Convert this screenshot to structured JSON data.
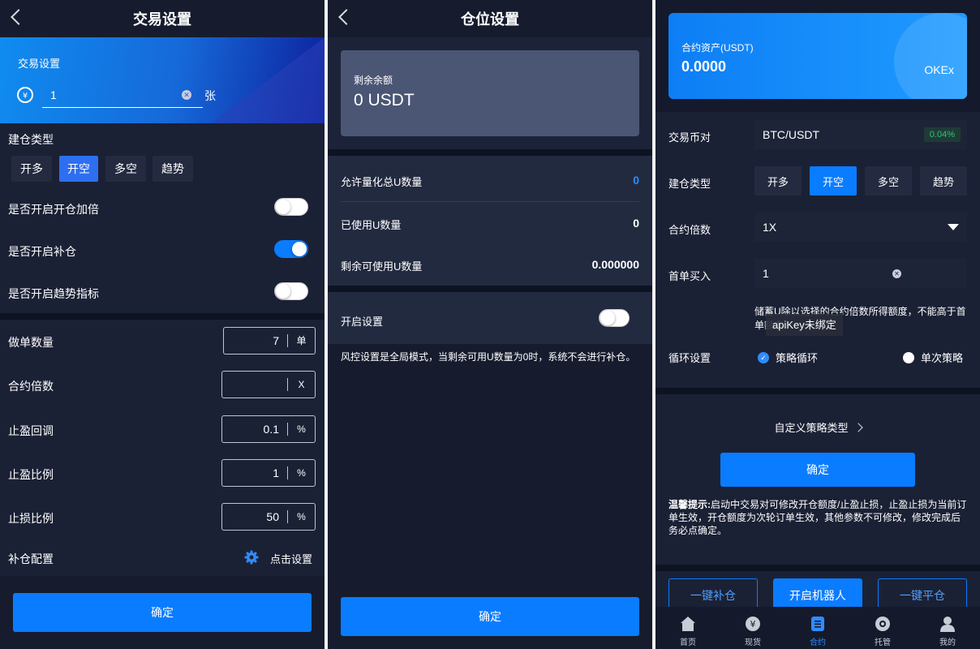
{
  "p1": {
    "title": "交易设置",
    "banner_label": "交易设置",
    "qty_value": "1",
    "qty_unit": "张",
    "build_type_label": "建仓类型",
    "build_types": [
      "开多",
      "开空",
      "多空",
      "趋势"
    ],
    "toggles": [
      {
        "label": "是否开启开仓加倍",
        "on": false
      },
      {
        "label": "是否开启补仓",
        "on": true
      },
      {
        "label": "是否开启趋势指标",
        "on": false
      }
    ],
    "fields": [
      {
        "label": "做单数量",
        "value": "7",
        "unit": "单"
      },
      {
        "label": "合约倍数",
        "value": "",
        "unit": "X"
      },
      {
        "label": "止盈回调",
        "value": "0.1",
        "unit": "%"
      },
      {
        "label": "止盈比例",
        "value": "1",
        "unit": "%"
      },
      {
        "label": "止损比例",
        "value": "50",
        "unit": "%"
      }
    ],
    "bucang_label": "补仓配置",
    "bucang_action": "点击设置",
    "confirm": "确定"
  },
  "p2": {
    "title": "仓位设置",
    "balance_label": "剩余余额",
    "balance_value": "0 USDT",
    "rows": [
      {
        "label": "允许量化总U数量",
        "value": "0"
      },
      {
        "label": "已使用U数量",
        "value": "0"
      },
      {
        "label": "剩余可使用U数量",
        "value": "0.000000"
      }
    ],
    "open_label": "开启设置",
    "note": "风控设置是全局模式，当剩余可用U数量为0时，系统不会进行补仓。",
    "confirm": "确定"
  },
  "p3": {
    "asset_label": "合约资产(USDT)",
    "asset_value": "0.0000",
    "exchange": "OKEx",
    "pair_label": "交易币对",
    "pair_value": "BTC/USDT",
    "pair_change": "0.04%",
    "build_type_label": "建仓类型",
    "build_types": [
      "开多",
      "开空",
      "多空",
      "趋势"
    ],
    "leverage_label": "合约倍数",
    "leverage_value": "1X",
    "first_buy_label": "首单买入",
    "first_buy_value": "1",
    "hint_line1": "储蓄U除以选择的合约倍数所得额度，不能高于首",
    "hint_line2": "单额度",
    "tooltip": "apiKey未绑定",
    "cycle_label": "循环设置",
    "cycle_options": [
      "策略循环",
      "单次策略"
    ],
    "custom_type": "自定义策略类型",
    "confirm": "确定",
    "tip_bold": "温馨提示:",
    "tip_text": "启动中交易对可修改开仓额度/止盈止损，止盈止损为当前订单生效，开仓额度为次轮订单生效，其他参数不可修改，修改完成后务必点确定。",
    "actions": [
      "一键补仓",
      "开启机器人",
      "一键平仓"
    ],
    "nav": [
      "首页",
      "现货",
      "合约",
      "托管",
      "我的"
    ]
  },
  "colors": {
    "accent": "#0a7cff",
    "bg": "#161c2e",
    "green": "#2ec27e"
  }
}
